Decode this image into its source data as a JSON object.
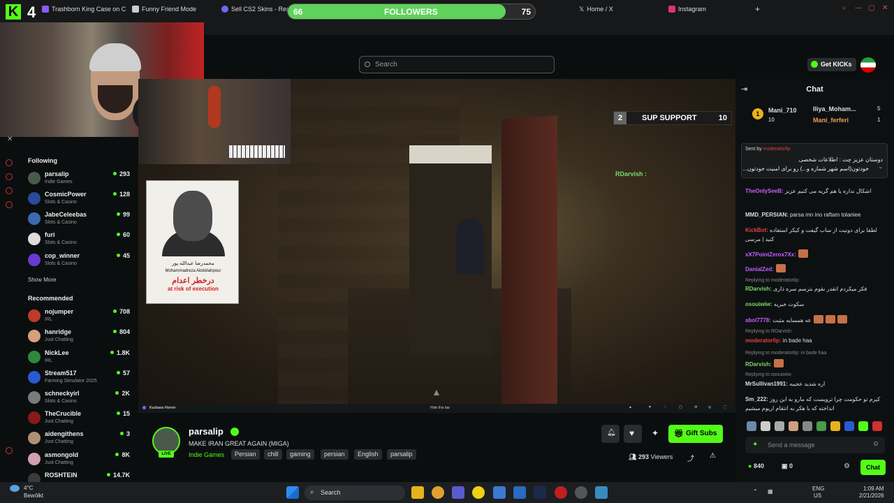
{
  "browser": {
    "tabs": [
      {
        "label": "Trashborn King Case on C",
        "color": "#8a5cf6"
      },
      {
        "label": "Funny Friend Mode",
        "color": "#cccccc"
      },
      {
        "label": "Sell CS2 Skins - Real",
        "color": "#6a6af0"
      },
      {
        "label": "Home / X",
        "color": "#ffffff"
      },
      {
        "label": "Instagram",
        "color": "#e1306c"
      }
    ],
    "new_tab": "+",
    "toolbar_ai": "AI"
  },
  "followers_goal": {
    "current": "66",
    "label": "FOLLOWERS",
    "target": "75",
    "progress": 0.88
  },
  "overlay": {
    "logo_letter": "K",
    "count": "4"
  },
  "search": {
    "placeholder": "Search"
  },
  "header": {
    "get_kicks": "Get KICKs"
  },
  "sidebar": {
    "following_title": "Following",
    "following": [
      {
        "name": "parsalip",
        "category": "Indie Games",
        "viewers": "293",
        "color": "#4a5a4a"
      },
      {
        "name": "CosmicPower",
        "category": "Slots & Casino",
        "viewers": "128",
        "color": "#2a4a9a"
      },
      {
        "name": "JabeCeleebas",
        "category": "Slots & Casino",
        "viewers": "99",
        "color": "#3a6ab0"
      },
      {
        "name": "furi",
        "category": "Slots & Casino",
        "viewers": "60",
        "color": "#dddddd"
      },
      {
        "name": "cop_winner",
        "category": "Slots & Casino",
        "viewers": "45",
        "color": "#6a3ad0"
      }
    ],
    "show_more": "Show More",
    "recommended_title": "Recommended",
    "recommended": [
      {
        "name": "nojumper",
        "category": "IRL",
        "viewers": "708",
        "color": "#c03a2a"
      },
      {
        "name": "hanridge",
        "category": "Just Chatting",
        "viewers": "804",
        "color": "#d6a07a"
      },
      {
        "name": "NickLee",
        "category": "IRL",
        "viewers": "1.8K",
        "color": "#2a8a3a"
      },
      {
        "name": "Stream517",
        "category": "Farming Simulator 2025",
        "viewers": "57",
        "color": "#2a5ad0"
      },
      {
        "name": "schneckyirl",
        "category": "Slots & Casino",
        "viewers": "2K",
        "color": "#7a7a7a"
      },
      {
        "name": "TheCrucible",
        "category": "Just Chatting",
        "viewers": "15",
        "color": "#8a1a1a"
      },
      {
        "name": "aidengithens",
        "category": "Just Chatting",
        "viewers": "3",
        "color": "#b09070"
      },
      {
        "name": "asmongold",
        "category": "Just Chatting",
        "viewers": "8K",
        "color": "#d0a0b0"
      },
      {
        "name": "ROSHTEIN",
        "category": "",
        "viewers": "14.7K",
        "color": "#3a3a3a"
      }
    ]
  },
  "video": {
    "sup_left": "2",
    "sup_label": "SUP SUPPORT",
    "sup_right": "10",
    "overlay_user": "RDarvish :",
    "poster_fa_name": "محمدرضا عبدالله پور",
    "poster_en_name": "Mohammadreza Abdollahpour",
    "poster_fa_risk": "درخطر اعدام",
    "poster_en_risk": "at risk of execution",
    "bottom_left": "Kuzbass Horror",
    "bottom_mid": "Hide this bar"
  },
  "stream": {
    "name": "parsalip",
    "title": "MAKE IRAN GREAT AGAIN (MIGA)",
    "category": "Indie Games",
    "tags": [
      "Persian",
      "chill",
      "gaming",
      "persian",
      "English",
      "parsalip"
    ],
    "live": "LIVE",
    "gift_subs": "Gift Subs",
    "viewers": "293",
    "viewers_label": "Viewers"
  },
  "chat": {
    "title": "Chat",
    "gifters": [
      {
        "rank": "1",
        "name": "Mani_710",
        "count": "10"
      },
      {
        "name": "Iliya_Moham...",
        "count": "5"
      },
      {
        "name": "Mani_ferferi",
        "count": "1"
      }
    ],
    "pinned": {
      "sent_by": "Sent by",
      "user": "moderatorlip",
      "line1": "دوستان عزیز چت : اطلاعات شخصی",
      "line2": "خودتون(اسم شهر شماره و...) رو برای امنیت خودتون..."
    },
    "messages": [
      {
        "user": "Sm_222",
        "text": "اشکال نداره یا هم گریه می کنیم عزیز",
        "color": "#c060ff",
        "prefix": "TheOnlySeeB:"
      },
      {
        "user": "MMD_PERSIAN:",
        "text": "parsa mn ino raftam tolaniee",
        "color": "#ddd"
      },
      {
        "user": "KickBot:",
        "text": "لطفا برای دونیت از ساب گیفت و کیکز استفاده کنید | مرسی",
        "color": "#e04040"
      },
      {
        "user": "xX7PointZerox7Xx:",
        "text": "",
        "color": "#c060ff"
      },
      {
        "user": "DanialZed:",
        "text": "",
        "color": "#c060ff"
      },
      {
        "user": "RDarvish:",
        "text": "فکر میکردم انقدر نقوم بترسم سره ذاری",
        "color": "#7cd96c",
        "reply": "Replying to moderatorlip:"
      },
      {
        "user": "osouiwiw:",
        "text": "سکوت خبریه",
        "color": "#7cd96c"
      },
      {
        "user": "abol7778:",
        "text": "عه همسایه مثبت",
        "color": "#c060ff"
      },
      {
        "user": "moderatorlip:",
        "text": "in bade haa",
        "color": "#e04040",
        "reply": "Replying to RDarvish:"
      },
      {
        "user": "RDarvish:",
        "text": "",
        "color": "#7cd96c",
        "reply": "Replying to moderatorlip: in bade haa"
      },
      {
        "user": "MrSullivan1991:",
        "text": "اره شدید عجیبه",
        "color": "#ddd",
        "reply": "Replying to osouiwiw:"
      },
      {
        "user": "Sm_222:",
        "text": "کیرم تو حکومت چرا ترویست که مارو به این روز انداخته که با هکر به انتقام اریوم میشیم",
        "color": "#ddd"
      }
    ],
    "send_placeholder": "Send a message",
    "kicks_count": "840",
    "points": "0",
    "chat_button": "Chat"
  },
  "taskbar": {
    "weather_temp": "4°C",
    "weather_desc": "Bewölkt",
    "search": "Search",
    "lang1": "ENG",
    "lang2": "US",
    "time": "1:09 AM",
    "date": "2/21/2026"
  }
}
